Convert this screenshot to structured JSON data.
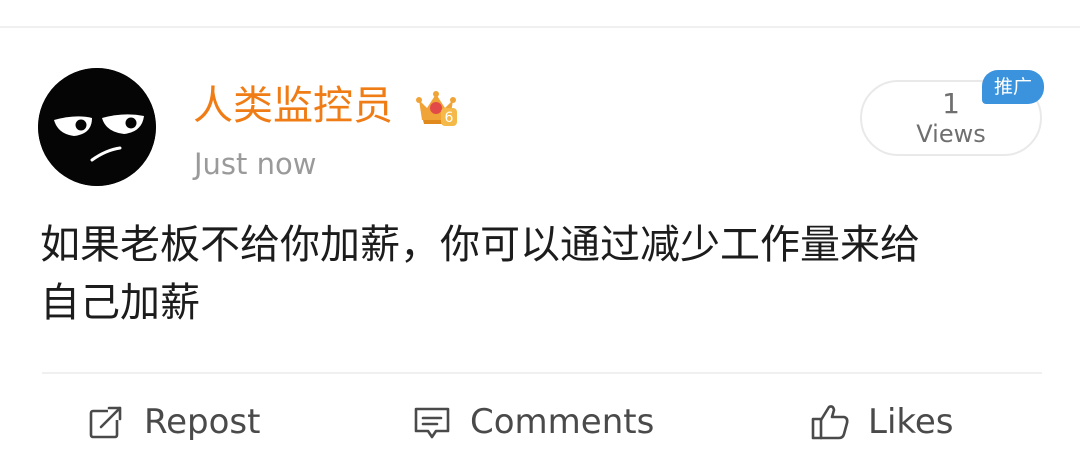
{
  "post": {
    "author": {
      "name": "人类监控员",
      "badge_icon": "crown-level-badge-icon",
      "badge_level": "6",
      "avatar_icon": "black-face-avatar-icon"
    },
    "timestamp": "Just now",
    "views": {
      "count": "1",
      "label": "Views",
      "promo_tag": "推广"
    },
    "content": {
      "line1": "如果老板不给你加薪，你可以通过减少工作量来给",
      "line2": "自己加薪"
    }
  },
  "actions": {
    "repost": {
      "label": "Repost",
      "icon": "repost-icon"
    },
    "comments": {
      "label": "Comments",
      "icon": "comment-icon"
    },
    "likes": {
      "label": "Likes",
      "icon": "thumbs-up-icon"
    }
  },
  "colors": {
    "username": "#f07c15",
    "timestamp": "#9a9a9a",
    "body_text": "#1c1c1c",
    "promo_tag_bg": "#3b93dd",
    "action_text": "#4a4a4a",
    "divider": "#f0f0f0"
  }
}
